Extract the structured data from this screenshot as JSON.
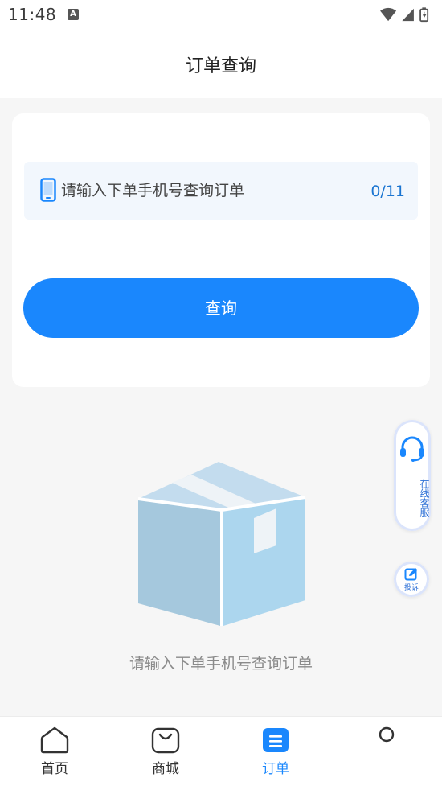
{
  "status_bar": {
    "time": "11:48",
    "notification_letter": "A"
  },
  "header": {
    "title": "订单查询"
  },
  "search": {
    "placeholder": "请输入下单手机号查询订单",
    "counter": "0/11",
    "button_label": "查询"
  },
  "empty_state": {
    "message": "请输入下单手机号查询订单"
  },
  "floating": {
    "service_label": "在线客服",
    "complain_label": "投诉"
  },
  "tabs": [
    {
      "label": "首页",
      "icon": "home-icon",
      "active": false
    },
    {
      "label": "商城",
      "icon": "shopping-bag-icon",
      "active": false
    },
    {
      "label": "订单",
      "icon": "order-list-icon",
      "active": true
    },
    {
      "label": "",
      "icon": "profile-icon",
      "active": false
    }
  ],
  "colors": {
    "accent": "#1a87fd",
    "field_background": "#f2f7fd",
    "page_background": "#f6f6f6"
  }
}
